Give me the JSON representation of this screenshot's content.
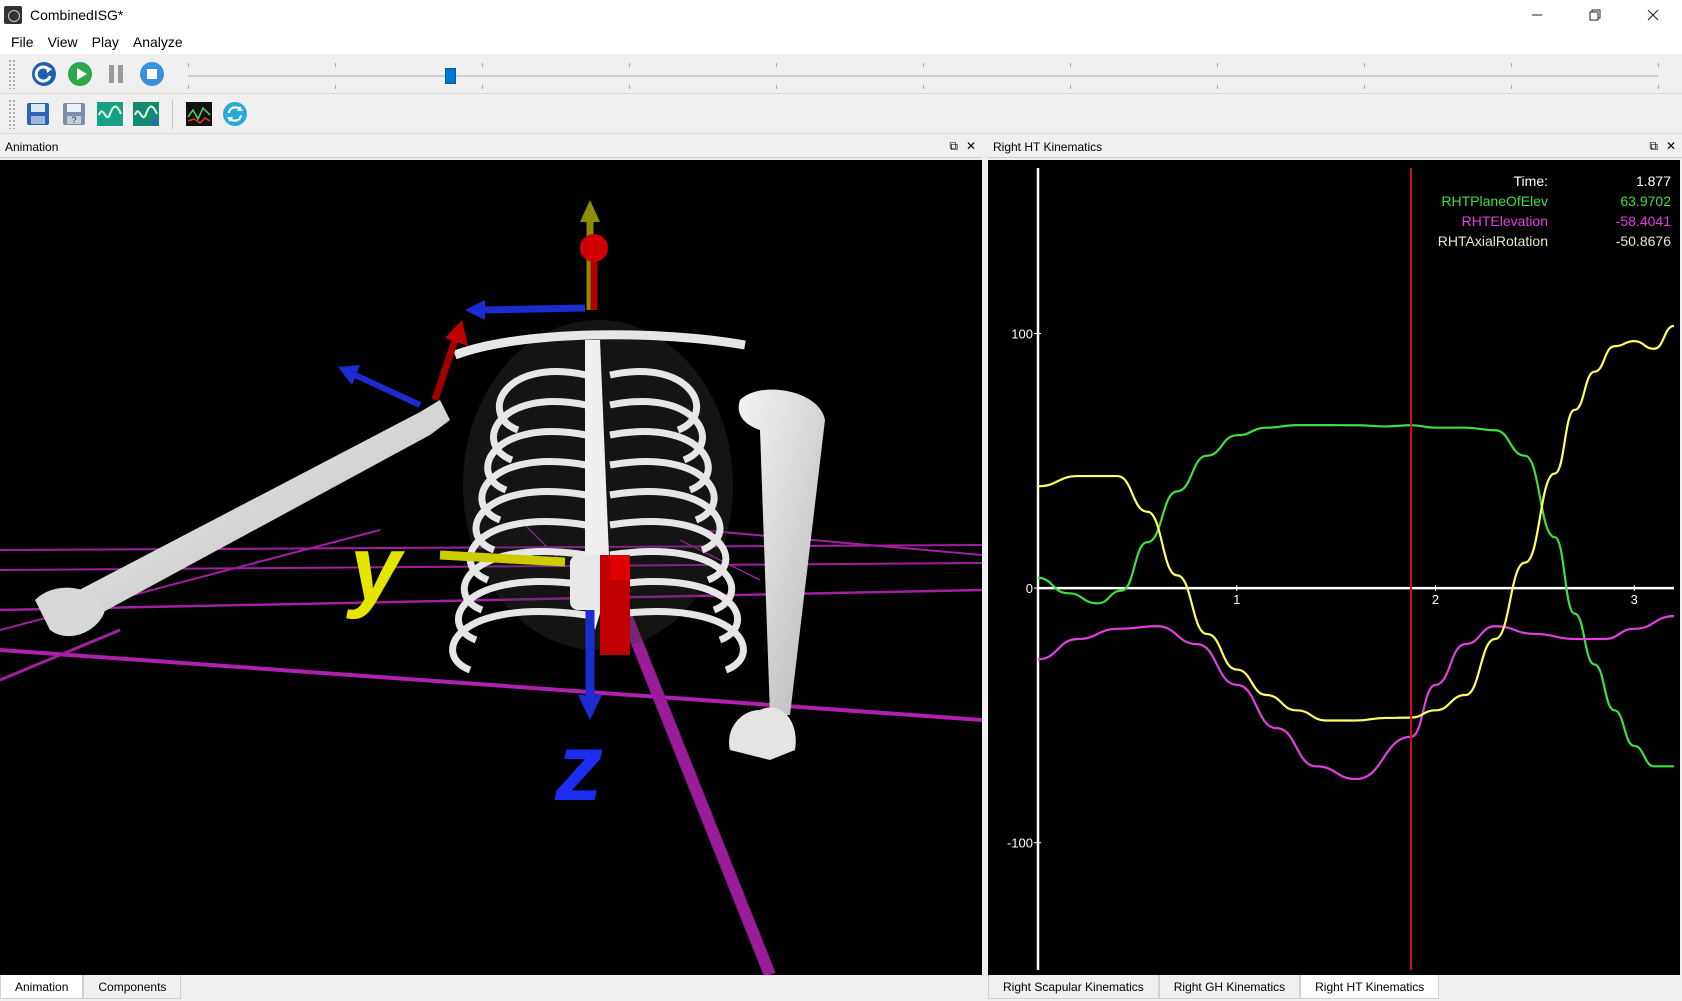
{
  "window": {
    "title": "CombinedISG*"
  },
  "menu": {
    "file": "File",
    "view": "View",
    "play": "Play",
    "analyze": "Analyze"
  },
  "toolbar": {
    "top_icons": [
      "refresh-icon",
      "play-icon",
      "pause-icon",
      "stop-icon"
    ],
    "bottom_icons": [
      "save-icon",
      "save-as-icon",
      "motion-icon",
      "motion-edit-icon",
      "plot-icon",
      "sync-icon"
    ]
  },
  "timeline": {
    "position": 0.175
  },
  "panels": {
    "animation_title": "Animation",
    "plot_title": "Right HT Kinematics"
  },
  "scene": {
    "axis_y_label": "y",
    "axis_z_label": "z"
  },
  "readout": {
    "time_label": "Time:",
    "time_value": "1.877",
    "rows": [
      {
        "label": "RHTPlaneOfElev",
        "value": "63.9702",
        "color": "#3ee03e"
      },
      {
        "label": "RHTElevation",
        "value": "-58.4041",
        "color": "#e040e0"
      },
      {
        "label": "RHTAxialRotation",
        "value": "-50.8676",
        "color": "#ffff60"
      }
    ]
  },
  "chart_data": {
    "type": "line",
    "xlim": [
      0.0,
      3.2
    ],
    "ylim": [
      -150,
      165
    ],
    "x_ticks": [
      "1",
      "2",
      "3"
    ],
    "y_ticks": [
      "100",
      "0",
      "-100"
    ],
    "grid": false,
    "cursor_x": 1.877,
    "series": [
      {
        "name": "RHTPlaneOfElev",
        "color": "#3ee03e",
        "x": [
          0,
          0.15,
          0.3,
          0.42,
          0.55,
          0.7,
          0.85,
          1.0,
          1.15,
          1.3,
          1.45,
          1.6,
          1.75,
          1.877,
          2.0,
          2.15,
          2.3,
          2.45,
          2.6,
          2.7,
          2.8,
          2.9,
          3.0,
          3.1,
          3.2
        ],
        "y": [
          4,
          -2,
          -6,
          -1,
          18,
          38,
          52,
          60,
          63,
          64,
          64,
          63.97,
          63.5,
          63.97,
          63,
          63,
          62,
          52,
          20,
          -10,
          -30,
          -48,
          -62,
          -70,
          -70
        ]
      },
      {
        "name": "RHTElevation",
        "color": "#e040e0",
        "x": [
          0,
          0.2,
          0.4,
          0.6,
          0.8,
          1.0,
          1.2,
          1.4,
          1.6,
          1.877,
          2.0,
          2.15,
          2.3,
          2.5,
          2.7,
          2.85,
          3.0,
          3.2
        ],
        "y": [
          -28,
          -20,
          -16,
          -15,
          -22,
          -38,
          -55,
          -70,
          -75,
          -58.4,
          -38,
          -22,
          -15,
          -18,
          -20,
          -20,
          -16,
          -11
        ]
      },
      {
        "name": "RHTAxialRotation",
        "color": "#ffff60",
        "x": [
          0,
          0.2,
          0.4,
          0.55,
          0.7,
          0.85,
          1.0,
          1.15,
          1.3,
          1.45,
          1.6,
          1.75,
          1.877,
          2.0,
          2.15,
          2.3,
          2.45,
          2.6,
          2.7,
          2.8,
          2.9,
          3.0,
          3.1,
          3.2
        ],
        "y": [
          40,
          44,
          44,
          30,
          5,
          -18,
          -32,
          -42,
          -48,
          -52,
          -52,
          -51,
          -50.87,
          -48,
          -42,
          -20,
          10,
          45,
          70,
          85,
          95,
          97,
          94,
          103
        ]
      }
    ]
  },
  "tabs": {
    "left": [
      "Animation",
      "Components"
    ],
    "right": [
      "Right Scapular Kinematics",
      "Right GH Kinematics",
      "Right HT Kinematics"
    ]
  }
}
